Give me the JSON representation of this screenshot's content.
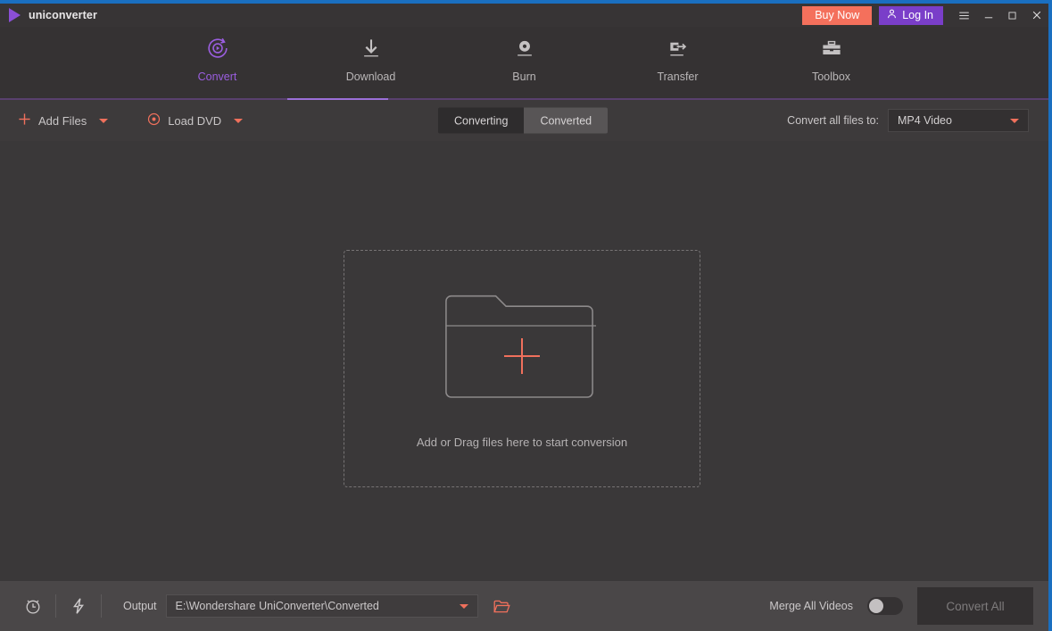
{
  "window": {
    "brand_name": "uniconverter",
    "logo_icon": "play-triangle-icon",
    "buy_now_label": "Buy Now",
    "login_label": "Log In",
    "login_icon": "user-icon",
    "menu_icon": "hamburger-menu-icon",
    "minimize_icon": "minimize-icon",
    "maximize_icon": "maximize-icon",
    "close_icon": "close-icon",
    "accent_blue": "#1a6fc0",
    "accent_purple": "#9b5ee0",
    "accent_salmon": "#f0705c"
  },
  "nav": {
    "items": [
      {
        "label": "Convert",
        "icon": "convert-circular-play-icon",
        "active": true
      },
      {
        "label": "Download",
        "icon": "download-arrow-icon",
        "active": false
      },
      {
        "label": "Burn",
        "icon": "burn-disc-icon",
        "active": false
      },
      {
        "label": "Transfer",
        "icon": "transfer-device-arrow-icon",
        "active": false
      },
      {
        "label": "Toolbox",
        "icon": "toolbox-icon",
        "active": false
      }
    ]
  },
  "toolbar": {
    "add_files_label": "Add Files",
    "add_files_icon": "plus-icon",
    "add_files_caret": "chevron-down-icon",
    "load_dvd_label": "Load DVD",
    "load_dvd_icon": "disc-icon",
    "load_dvd_caret": "chevron-down-icon",
    "tabs": [
      {
        "label": "Converting",
        "active": true
      },
      {
        "label": "Converted",
        "active": false
      }
    ],
    "convert_all_to_label": "Convert all files to:",
    "format_value": "MP4 Video",
    "format_caret": "chevron-down-icon"
  },
  "main": {
    "dropzone_icon": "folder-with-plus-icon",
    "dropzone_text": "Add or Drag files here to start conversion"
  },
  "bottom": {
    "timer_icon": "alarm-clock-icon",
    "speed_icon": "lightning-bolt-icon",
    "output_label": "Output",
    "output_path": "E:\\Wondershare UniConverter\\Converted",
    "output_caret": "chevron-down-icon",
    "open_folder_icon": "open-folder-icon",
    "merge_label": "Merge All Videos",
    "merge_enabled": false,
    "convert_all_label": "Convert All",
    "convert_all_enabled": false
  }
}
